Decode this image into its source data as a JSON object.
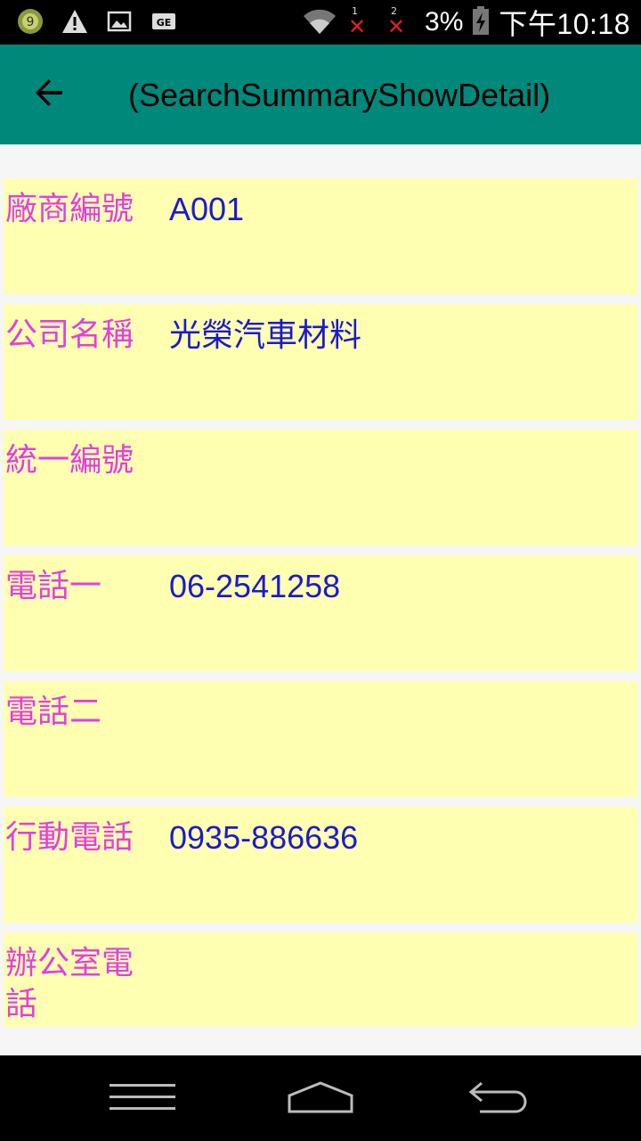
{
  "status_bar": {
    "notification_icons": [
      "number-9-badge-icon",
      "warning-icon",
      "image-icon",
      "sim-card-icon"
    ],
    "sim1_label": "1",
    "sim2_label": "2",
    "battery_percent": "3%",
    "time": "下午10:18"
  },
  "app_bar": {
    "title": "(SearchSummaryShowDetail)",
    "back_icon": "arrow-back-icon"
  },
  "fields": [
    {
      "label": "廠商編號",
      "value": "A001"
    },
    {
      "label": "公司名稱",
      "value": "光榮汽車材料"
    },
    {
      "label": "統一編號",
      "value": ""
    },
    {
      "label": "電話一",
      "value": "06-2541258"
    },
    {
      "label": "電話二",
      "value": ""
    },
    {
      "label": "行動電話",
      "value": "0935-886636"
    },
    {
      "label": "辦公室電話",
      "value": ""
    }
  ],
  "colors": {
    "app_bar": "#00897b",
    "row_background": "#ffffb2",
    "label_text": "#e040e0",
    "value_text": "#1a1ad0"
  },
  "nav_bar": {
    "icons": [
      "menu-icon",
      "home-icon",
      "back-icon"
    ]
  }
}
